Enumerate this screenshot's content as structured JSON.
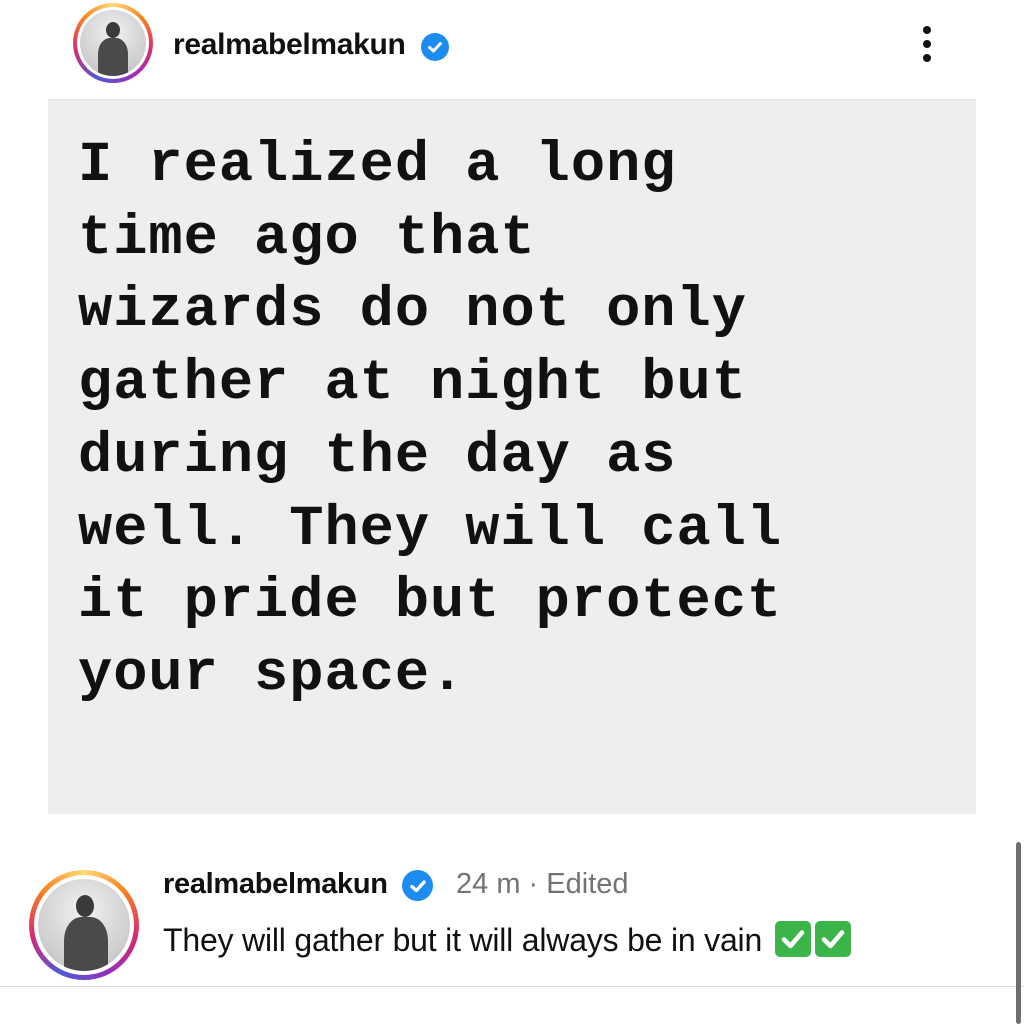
{
  "header": {
    "username": "realmabelmakun",
    "verified_icon": "verified-badge-icon",
    "more_icon": "more-vertical-icon"
  },
  "post": {
    "quote_lines": [
      "I realized a long",
      "time ago that",
      "wizards do not only",
      "gather at night but",
      "during the day as",
      "well. They will call",
      "it pride but protect",
      "your space."
    ],
    "background_color": "#eeeeee"
  },
  "caption": {
    "username": "realmabelmakun",
    "time": "24 m",
    "separator": "·",
    "edited": "Edited",
    "text": "They will gather but it will always be in vain",
    "emoji_icons": [
      "check-mark-button-icon",
      "check-mark-button-icon"
    ]
  },
  "colors": {
    "verified_blue": "#1d8cf0",
    "meta_gray": "#737373",
    "check_green": "#3bb54a"
  }
}
